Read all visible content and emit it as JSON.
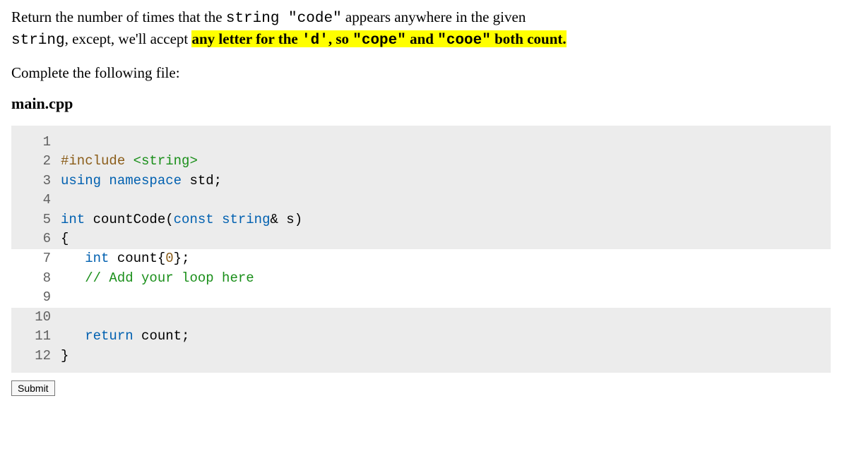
{
  "problem": {
    "pre1": "Return the number of times that the ",
    "mono1": "string \"code\"",
    "mid1": " appears anywhere in the given ",
    "mono2": "string",
    "mid2": ", except, we'll accept ",
    "hl_pre": "any letter for the ",
    "hl_mono1": "'d'",
    "hl_mid1": ", so ",
    "hl_mono2": "\"cope\"",
    "hl_mid2": " and ",
    "hl_mono3": "\"cooe\"",
    "hl_post": " both count."
  },
  "instruction": "Complete the following file:",
  "filename": "main.cpp",
  "code": {
    "lines": [
      {
        "num": "1",
        "editable": false,
        "tokens": []
      },
      {
        "num": "2",
        "editable": false,
        "tokens": [
          {
            "cls": "tok-pp",
            "t": "#include"
          },
          {
            "cls": "",
            "t": " "
          },
          {
            "cls": "tok-inc",
            "t": "<string>"
          }
        ]
      },
      {
        "num": "3",
        "editable": false,
        "tokens": [
          {
            "cls": "tok-kw",
            "t": "using"
          },
          {
            "cls": "",
            "t": " "
          },
          {
            "cls": "tok-kw",
            "t": "namespace"
          },
          {
            "cls": "",
            "t": " std;"
          }
        ]
      },
      {
        "num": "4",
        "editable": false,
        "tokens": []
      },
      {
        "num": "5",
        "editable": false,
        "tokens": [
          {
            "cls": "tok-type",
            "t": "int"
          },
          {
            "cls": "",
            "t": " countCode("
          },
          {
            "cls": "tok-kw",
            "t": "const"
          },
          {
            "cls": "",
            "t": " "
          },
          {
            "cls": "tok-type",
            "t": "string"
          },
          {
            "cls": "",
            "t": "& s)"
          }
        ]
      },
      {
        "num": "6",
        "editable": false,
        "tokens": [
          {
            "cls": "",
            "t": "{"
          }
        ]
      },
      {
        "num": "7",
        "editable": true,
        "tokens": [
          {
            "cls": "",
            "t": "   "
          },
          {
            "cls": "tok-type",
            "t": "int"
          },
          {
            "cls": "",
            "t": " count{"
          },
          {
            "cls": "tok-num",
            "t": "0"
          },
          {
            "cls": "",
            "t": "};"
          }
        ]
      },
      {
        "num": "8",
        "editable": true,
        "tokens": [
          {
            "cls": "",
            "t": "   "
          },
          {
            "cls": "tok-cm",
            "t": "// Add your loop here"
          }
        ]
      },
      {
        "num": "9",
        "editable": true,
        "tokens": []
      },
      {
        "num": "10",
        "editable": false,
        "tokens": []
      },
      {
        "num": "11",
        "editable": false,
        "tokens": [
          {
            "cls": "",
            "t": "   "
          },
          {
            "cls": "tok-kw",
            "t": "return"
          },
          {
            "cls": "",
            "t": " count;"
          }
        ]
      },
      {
        "num": "12",
        "editable": false,
        "tokens": [
          {
            "cls": "",
            "t": "}"
          }
        ]
      }
    ]
  },
  "submit_label": "Submit"
}
